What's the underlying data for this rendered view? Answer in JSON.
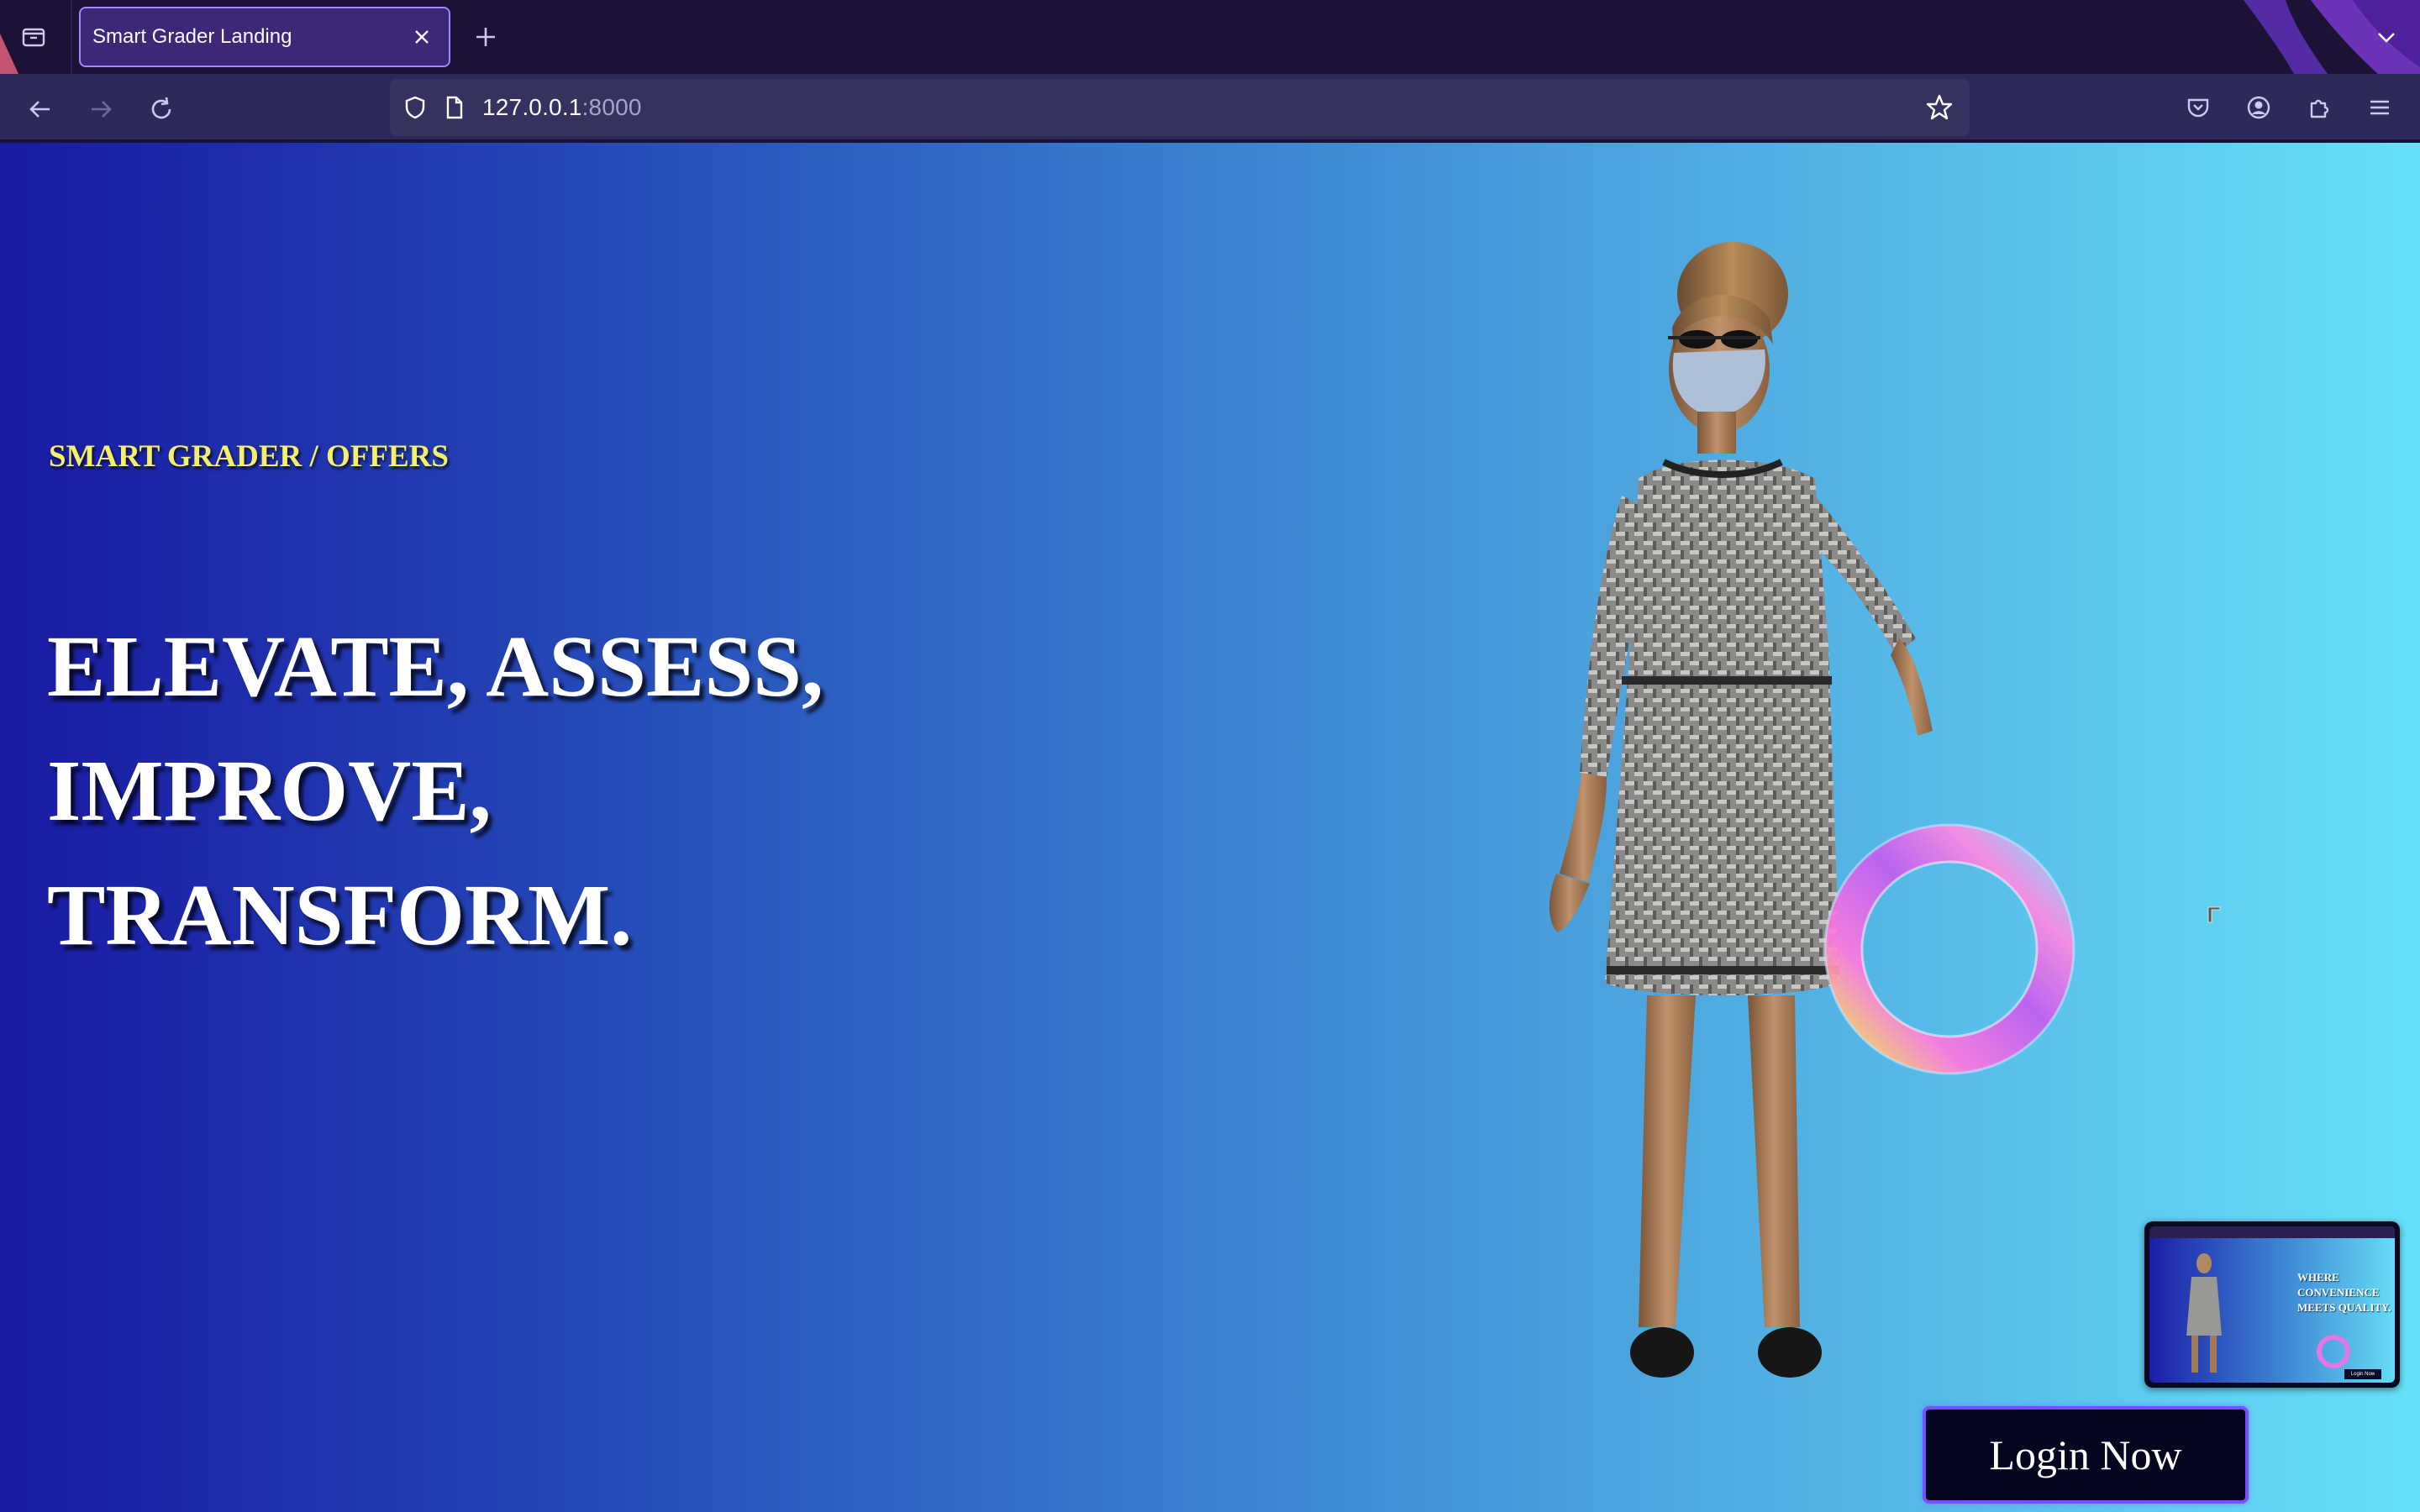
{
  "browser": {
    "tab_title": "Smart Grader Landing",
    "url_host": "127.0.0.1",
    "url_port": ":8000",
    "icons": {
      "sidebar": "sidebar-icon",
      "close": "close-icon",
      "new_tab": "plus-icon",
      "tab_list": "chevron-down-icon",
      "back": "arrow-left-icon",
      "forward": "arrow-right-icon",
      "reload": "reload-icon",
      "shield": "shield-icon",
      "page": "page-icon",
      "bookmark": "star-icon",
      "pocket": "pocket-icon",
      "account": "account-icon",
      "extensions": "puzzle-icon",
      "menu": "hamburger-menu-icon"
    }
  },
  "hero": {
    "eyebrow": "SMART GRADER / OFFERS",
    "headline_lines": [
      "ELEVATE, ASSESS,",
      "IMPROVE,",
      "TRANSFORM."
    ]
  },
  "preview": {
    "headline_lines": [
      "WHERE",
      "CONVENIENCE",
      "MEETS QUALITY."
    ],
    "button_label": "Login Now"
  },
  "cta": {
    "login_label": "Login Now"
  },
  "colors": {
    "eyebrow": "#f4f06a",
    "gradient_start": "#1a1aa3",
    "gradient_end": "#66e0f8",
    "button_bg": "#04061f",
    "button_border": "#7a4fff",
    "tab_accent": "#a286ff"
  }
}
